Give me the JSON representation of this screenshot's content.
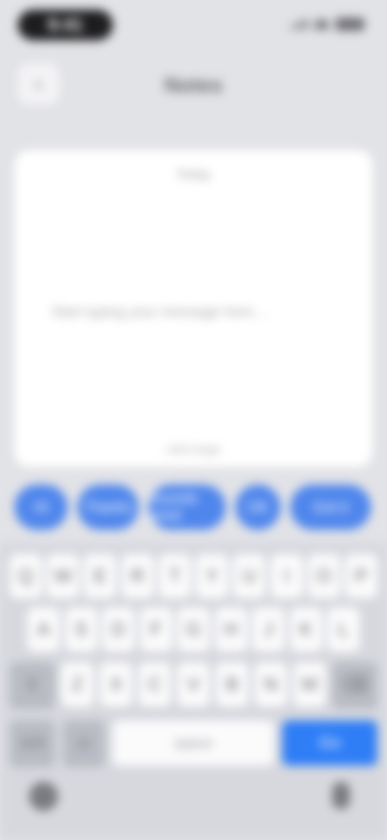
{
  "status": {
    "time": "9:41"
  },
  "nav": {
    "back_icon": "‹",
    "title": "Notes"
  },
  "card": {
    "top_label": "Today",
    "text": "Start typing your message here…",
    "bottom_label": "Add image"
  },
  "chips": [
    "Hi",
    "Thanks",
    "Sounds good",
    "OK",
    "Got it"
  ],
  "keyboard": {
    "row1": [
      "Q",
      "W",
      "E",
      "R",
      "T",
      "Y",
      "U",
      "I",
      "O",
      "P"
    ],
    "row2": [
      "A",
      "S",
      "D",
      "F",
      "G",
      "H",
      "J",
      "K",
      "L"
    ],
    "row3": [
      "⇧",
      "Z",
      "X",
      "C",
      "V",
      "B",
      "N",
      "M",
      "⌫"
    ],
    "num_label": "123",
    "emoji_label": "☺",
    "space_label": "space",
    "return_label": "Go"
  },
  "colors": {
    "accent": "#4f86ec",
    "return": "#2f7ef6"
  }
}
